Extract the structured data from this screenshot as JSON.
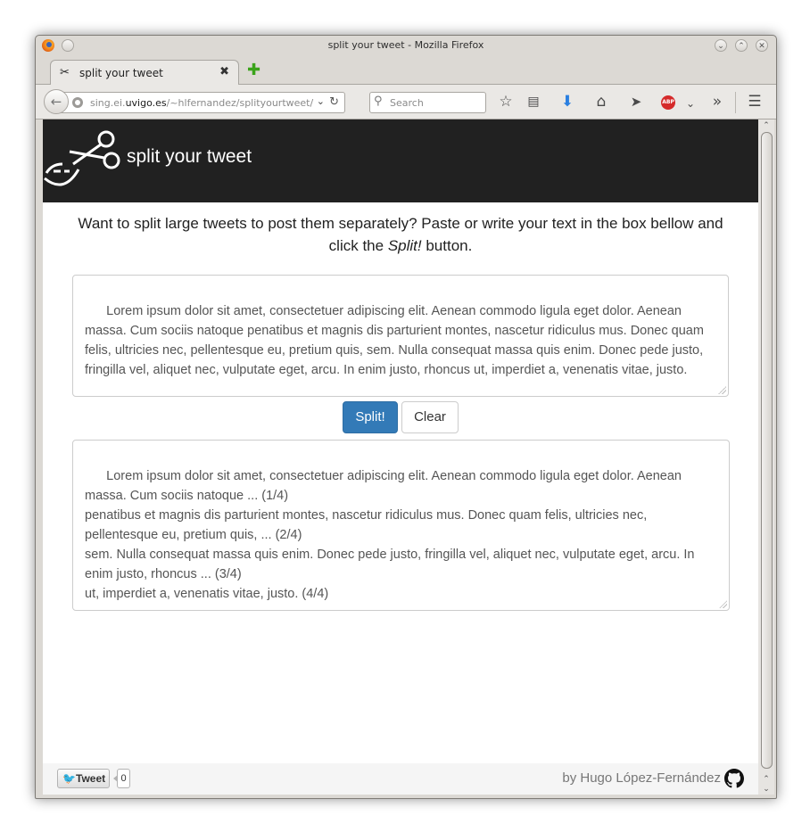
{
  "window": {
    "title": "split your tweet - Mozilla Firefox",
    "controls": [
      "minimize-icon",
      "maximize-icon",
      "close-icon"
    ]
  },
  "tab": {
    "label": "split your tweet",
    "close_glyph": "✖",
    "new_tab_glyph": "✚"
  },
  "navbar": {
    "url_prefix": "sing.ei.",
    "url_host": "uvigo.es",
    "url_path": "/~hlfernandez/splityourtweet/",
    "search_placeholder": "Search",
    "icons": [
      "back-arrow-icon",
      "globe-icon",
      "bookmark-star-icon",
      "reader-list-icon",
      "download-arrow-icon",
      "home-icon",
      "send-icon",
      "adblock-icon",
      "overflow-chevron-icon",
      "hamburger-menu-icon"
    ],
    "abp_label": "ABP"
  },
  "site": {
    "title": "split your tweet",
    "logo_icon": "scissors-bird-icon"
  },
  "intro": {
    "before": "Want to split large tweets to post them separately? Paste or write your text in the box bellow and click the ",
    "emphasis": "Split!",
    "after": " button."
  },
  "input": {
    "value": "Lorem ipsum dolor sit amet, consectetuer adipiscing elit. Aenean commodo ligula eget dolor. Aenean massa. Cum sociis natoque penatibus et magnis dis parturient montes, nascetur ridiculus mus. Donec quam felis, ultricies nec, pellentesque eu, pretium quis, sem. Nulla consequat massa quis enim. Donec pede justo, fringilla vel, aliquet nec, vulputate eget, arcu. In enim justo, rhoncus ut, imperdiet a, venenatis vitae, justo."
  },
  "buttons": {
    "split": "Split!",
    "clear": "Clear"
  },
  "output": {
    "value": "Lorem ipsum dolor sit amet, consectetuer adipiscing elit. Aenean commodo ligula eget dolor. Aenean massa. Cum sociis natoque ... (1/4)\npenatibus et magnis dis parturient montes, nascetur ridiculus mus. Donec quam felis, ultricies nec, pellentesque eu, pretium quis, ... (2/4)\nsem. Nulla consequat massa quis enim. Donec pede justo, fringilla vel, aliquet nec, vulputate eget, arcu. In enim justo, rhoncus ... (3/4)\nut, imperdiet a, venenatis vitae, justo. (4/4)"
  },
  "footer": {
    "tweet_label": "Tweet",
    "tweet_count": "0",
    "credit": "by Hugo López-Fernández",
    "github_icon": "github-icon"
  },
  "colors": {
    "header_bg": "#212121",
    "primary": "#337ab7",
    "footer_bg": "#f5f5f5"
  }
}
